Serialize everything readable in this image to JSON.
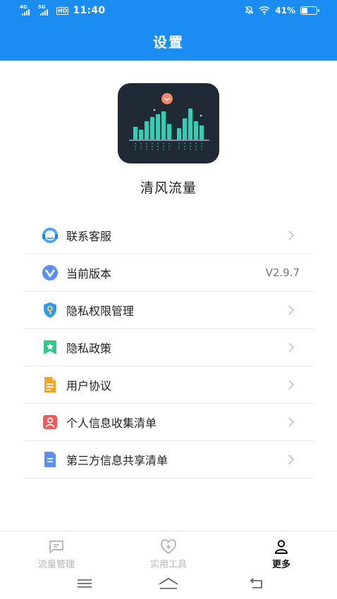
{
  "status_bar": {
    "sim1_label": "4G",
    "sim2_label": "5G",
    "hd_label": "HD",
    "time": "11:40",
    "battery_percent": "41%",
    "battery_level": 0.41
  },
  "header": {
    "title": "设置"
  },
  "app": {
    "name": "清风流量",
    "logo_icon": "audio-bars-logo"
  },
  "menu": {
    "items": [
      {
        "label": "联系客服",
        "icon": "customer-service-icon",
        "color": "#3b9cf5"
      },
      {
        "label": "当前版本",
        "icon": "version-icon",
        "color": "#5a8ef0",
        "value": "V2.9.7"
      },
      {
        "label": "隐私权限管理",
        "icon": "shield-icon",
        "color": "#2f9af3"
      },
      {
        "label": "隐私政策",
        "icon": "bookmark-star-icon",
        "color": "#34c98b"
      },
      {
        "label": "用户协议",
        "icon": "document-icon",
        "color": "#f6a623"
      },
      {
        "label": "个人信息收集清单",
        "icon": "person-card-icon",
        "color": "#f05a5a"
      },
      {
        "label": "第三方信息共享清单",
        "icon": "list-document-icon",
        "color": "#5b8ff0"
      }
    ]
  },
  "tabs": [
    {
      "label": "流量管理",
      "icon": "chat-box-icon"
    },
    {
      "label": "实用工具",
      "icon": "heart-plus-icon"
    },
    {
      "label": "更多",
      "icon": "person-icon",
      "active": true
    }
  ],
  "colors": {
    "brand": "#1a8cf2",
    "active_tab": "#111111",
    "inactive_tab": "#b8b8b8"
  }
}
